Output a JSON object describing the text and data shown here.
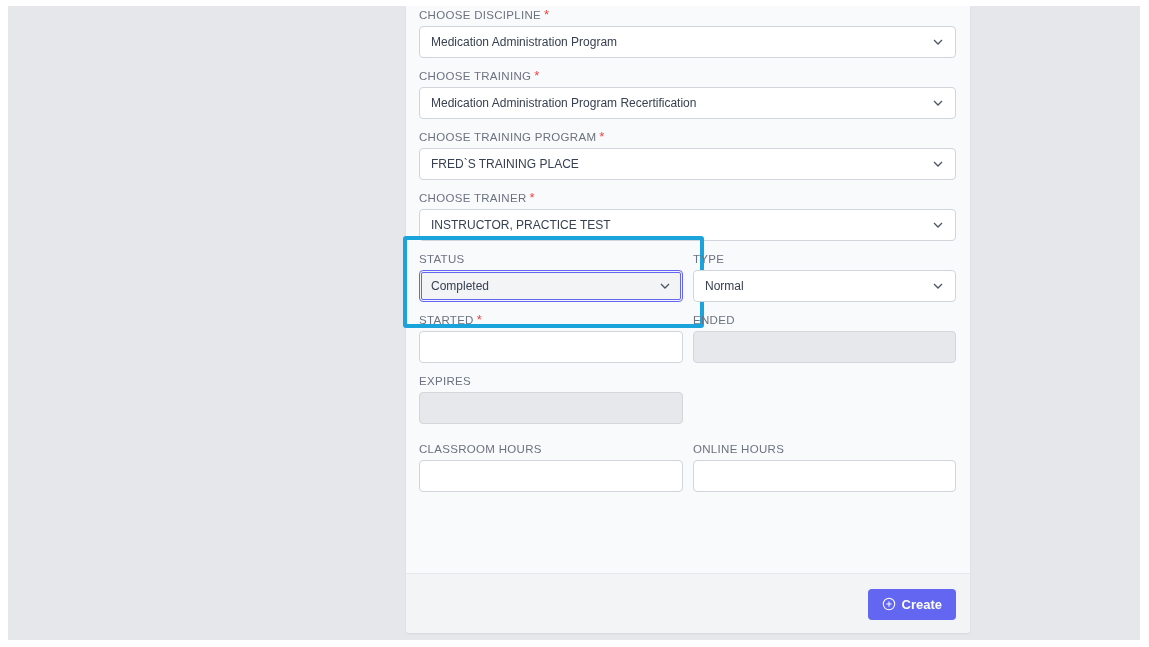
{
  "fields": [
    {
      "label": "CHOOSE DISCIPLINE",
      "required_mark": "*",
      "kind": "select",
      "wide": true,
      "value": "Medication Administration Program",
      "focused": false,
      "highlighted": false,
      "disabled": false
    },
    {
      "label": "CHOOSE TRAINING",
      "required_mark": "*",
      "kind": "select",
      "wide": true,
      "value": "Medication Administration Program Recertification",
      "focused": false,
      "highlighted": false,
      "disabled": false
    },
    {
      "label": "CHOOSE TRAINING PROGRAM",
      "required_mark": "*",
      "kind": "select",
      "wide": true,
      "value": "FRED`S TRAINING PLACE",
      "focused": false,
      "highlighted": false,
      "disabled": false
    },
    {
      "label": "CHOOSE TRAINER",
      "required_mark": "*",
      "kind": "select",
      "wide": true,
      "value": "INSTRUCTOR, PRACTICE TEST",
      "focused": false,
      "highlighted": false,
      "disabled": false
    },
    {
      "label": "STATUS",
      "kind": "select",
      "wide": false,
      "value": "Completed",
      "focused": true,
      "highlighted": true,
      "disabled": false
    },
    {
      "label": "TYPE",
      "kind": "select",
      "wide": false,
      "value": "Normal",
      "focused": false,
      "highlighted": false,
      "disabled": false
    },
    {
      "label": "STARTED",
      "required_mark": "*",
      "kind": "input",
      "wide": false,
      "focused": false,
      "highlighted": false,
      "disabled": false
    },
    {
      "label": "ENDED",
      "kind": "input",
      "wide": false,
      "focused": false,
      "highlighted": false,
      "disabled": true
    },
    {
      "label": "EXPIRES",
      "kind": "input",
      "wide": false,
      "focused": false,
      "highlighted": false,
      "disabled": true
    },
    {
      "label": "CLASSROOM HOURS",
      "kind": "input",
      "wide": false,
      "new_row": true,
      "focused": false,
      "highlighted": false,
      "disabled": false
    },
    {
      "label": "ONLINE HOURS",
      "kind": "input",
      "wide": false,
      "focused": false,
      "highlighted": false,
      "disabled": false
    }
  ],
  "submit": {
    "label": "Create"
  }
}
